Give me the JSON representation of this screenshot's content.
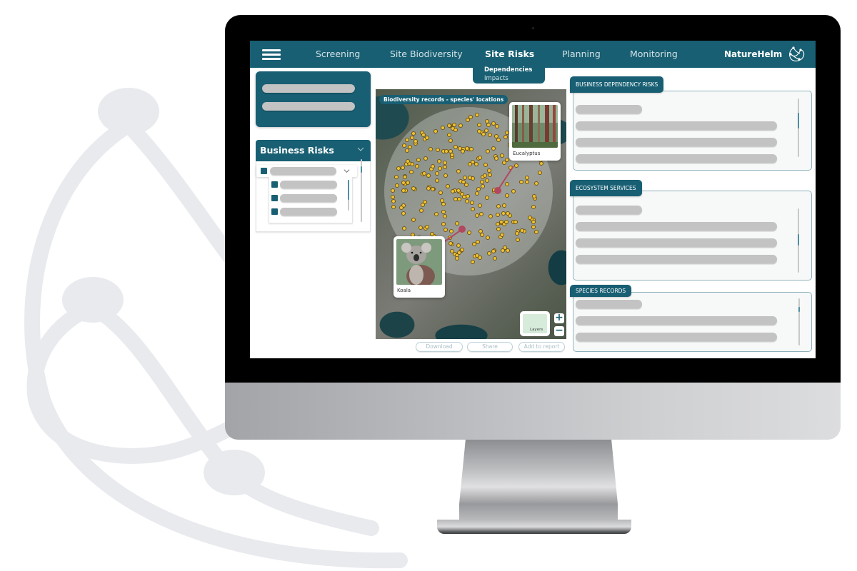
{
  "navbar": {
    "menu_icon": "hamburger-menu-icon",
    "items": [
      {
        "label": "Screening",
        "active": false
      },
      {
        "label": "Site Biodiversity",
        "active": false
      },
      {
        "label": "Site Risks",
        "active": true
      },
      {
        "label": "Planning",
        "active": false
      },
      {
        "label": "Monitoring",
        "active": false
      }
    ],
    "submenu": [
      {
        "label": "Dependencies",
        "active": true
      },
      {
        "label": "Impacts",
        "active": false
      }
    ],
    "brand": "NatureHelm",
    "brand_icon": "naturehelm-logo-icon"
  },
  "left_panel": {
    "business_risks": {
      "title": "Business Risks",
      "expand_icon": "chevron-down-icon"
    }
  },
  "map": {
    "title": "Biodiversity records - species' locations",
    "species_cards": [
      {
        "label": "Eucalyptus",
        "image_icon": "eucalyptus-forest-photo"
      },
      {
        "label": "Koala",
        "image_icon": "koala-photo"
      }
    ],
    "layers_label": "Layers",
    "zoom_in": "+",
    "zoom_out": "−",
    "actions": [
      {
        "label": "Download"
      },
      {
        "label": "Share"
      },
      {
        "label": "Add to report"
      }
    ]
  },
  "right_panels": [
    {
      "title": "BUSINESS DEPENDENCY RISKS"
    },
    {
      "title": "ECOSYSTEM SERVICES"
    },
    {
      "title": "SPECIES RECORDS"
    }
  ],
  "colors": {
    "brand_teal": "#185f73",
    "pin_yellow": "#f1c332",
    "highlight_pin": "#b2485f",
    "placeholder_grey": "#c3c3c3"
  }
}
